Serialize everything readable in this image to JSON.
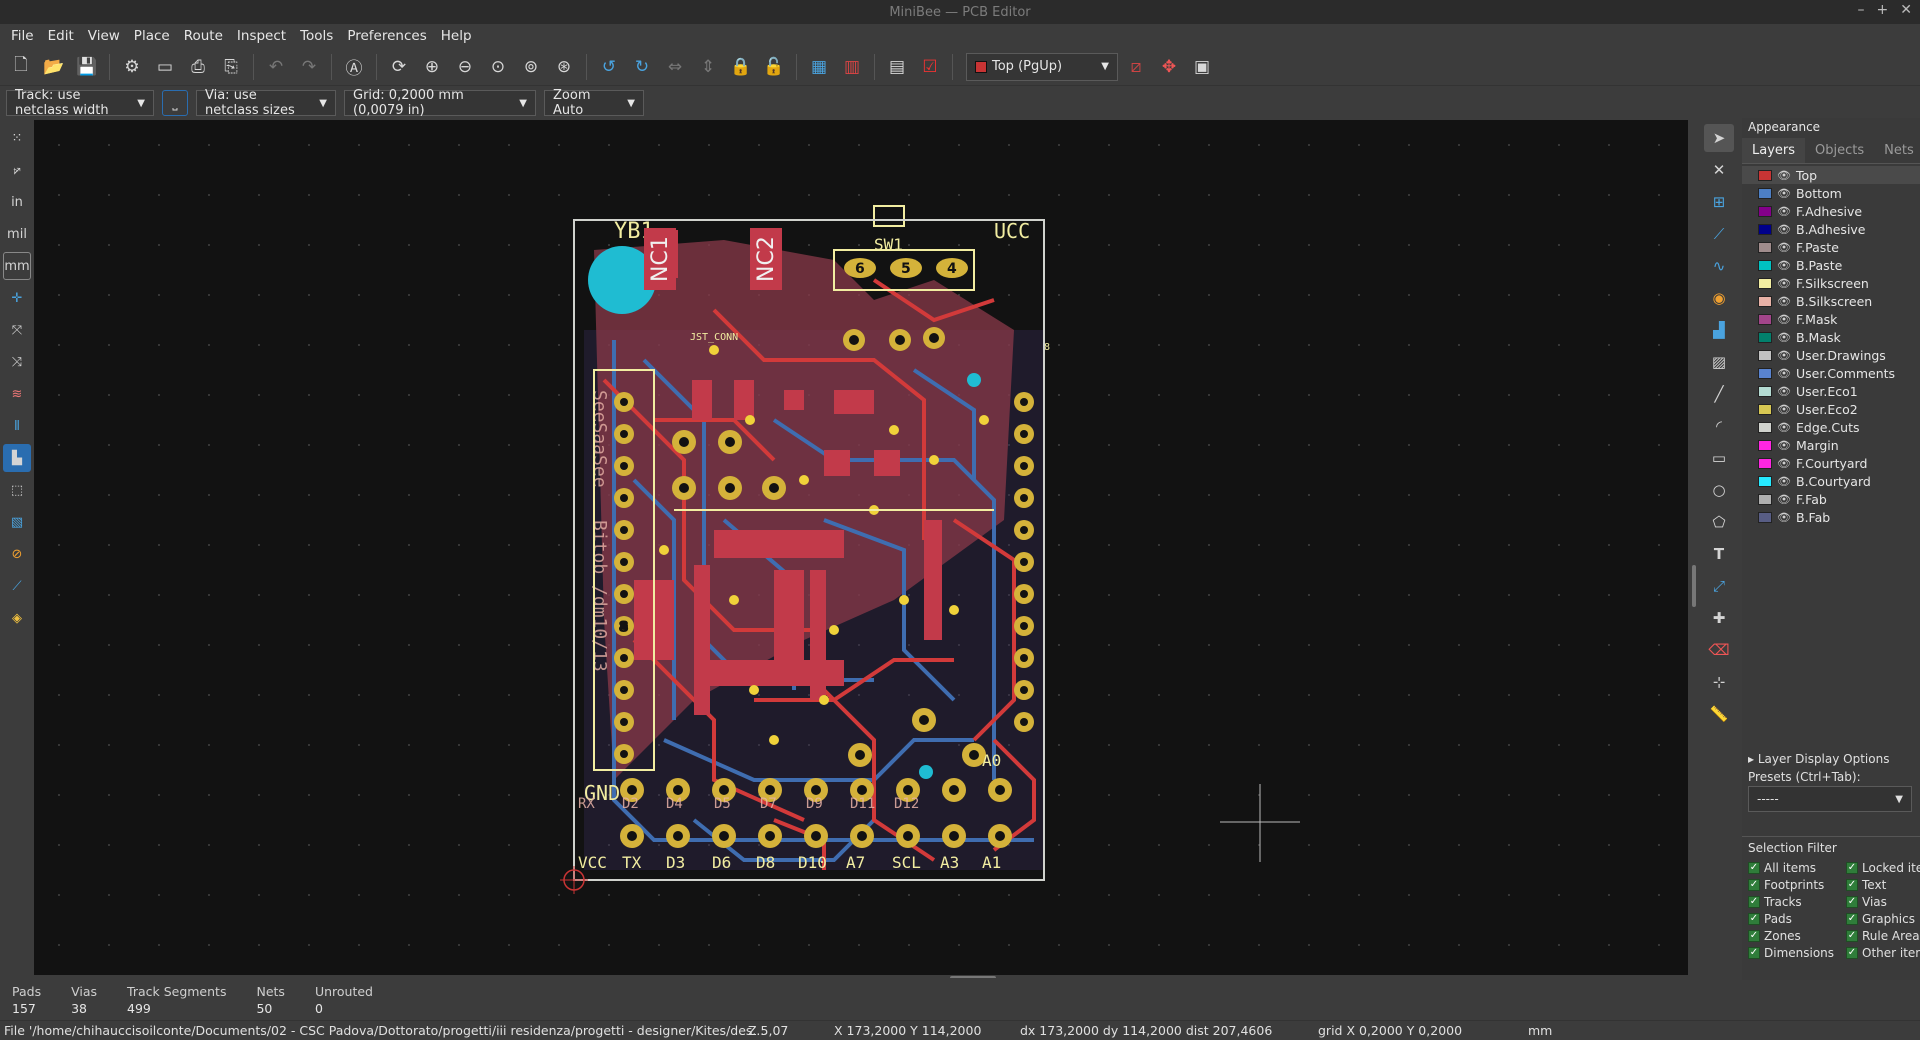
{
  "window": {
    "title": "MiniBee — PCB Editor",
    "controls": [
      "–",
      "+",
      "✕"
    ]
  },
  "menu": [
    "File",
    "Edit",
    "View",
    "Place",
    "Route",
    "Inspect",
    "Tools",
    "Preferences",
    "Help"
  ],
  "toolbar": {
    "layer_select": "Top (PgUp)",
    "track_width": "Track: use netclass width",
    "via_size": "Via: use netclass sizes",
    "grid": "Grid: 0,2000 mm (0,0079 in)",
    "zoom": "Zoom Auto"
  },
  "left_tools": [
    "grid-dots",
    "polar",
    "in",
    "mil",
    "mm",
    "cursor",
    "ratsnest",
    "curved-ratsnest",
    "hide-tracks",
    "show-tracks",
    "zone-fill",
    "zone-outline",
    "zone-none",
    "hv-45",
    "high-contrast",
    "layers-manager"
  ],
  "left_tool_labels": {
    "in": "in",
    "mil": "mil",
    "mm": "mm"
  },
  "appearance": {
    "title": "Appearance",
    "tabs": [
      "Layers",
      "Objects",
      "Nets"
    ],
    "active_tab": "Layers",
    "layers": [
      {
        "name": "Top",
        "color": "#c83434",
        "selected": true
      },
      {
        "name": "Bottom",
        "color": "#4d7fc4"
      },
      {
        "name": "F.Adhesive",
        "color": "#84008a"
      },
      {
        "name": "B.Adhesive",
        "color": "#00008a"
      },
      {
        "name": "F.Paste",
        "color": "#a08c8c"
      },
      {
        "name": "B.Paste",
        "color": "#00c2c2"
      },
      {
        "name": "F.Silkscreen",
        "color": "#f2eda1"
      },
      {
        "name": "B.Silkscreen",
        "color": "#e8b2a7"
      },
      {
        "name": "F.Mask",
        "color": "#a2458a"
      },
      {
        "name": "B.Mask",
        "color": "#02806c"
      },
      {
        "name": "User.Drawings",
        "color": "#c2c2c2"
      },
      {
        "name": "User.Comments",
        "color": "#5983cf"
      },
      {
        "name": "User.Eco1",
        "color": "#b4dbd2"
      },
      {
        "name": "User.Eco2",
        "color": "#d8c853"
      },
      {
        "name": "Edge.Cuts",
        "color": "#d0d2cd"
      },
      {
        "name": "Margin",
        "color": "#ff26e2"
      },
      {
        "name": "F.Courtyard",
        "color": "#ff26e2"
      },
      {
        "name": "B.Courtyard",
        "color": "#26e9ff"
      },
      {
        "name": "F.Fab",
        "color": "#afafaf"
      },
      {
        "name": "B.Fab",
        "color": "#585d84"
      }
    ],
    "layer_display_options": "Layer Display Options",
    "presets_label": "Presets (Ctrl+Tab):",
    "presets_value": "-----"
  },
  "selection_filter": {
    "title": "Selection Filter",
    "items": [
      "All items",
      "Locked ite",
      "Footprints",
      "Text",
      "Tracks",
      "Vias",
      "Pads",
      "Graphics",
      "Zones",
      "Rule Areas",
      "Dimensions",
      "Other item"
    ]
  },
  "stats": [
    {
      "label": "Pads",
      "value": "157"
    },
    {
      "label": "Vias",
      "value": "38"
    },
    {
      "label": "Track Segments",
      "value": "499"
    },
    {
      "label": "Nets",
      "value": "50"
    },
    {
      "label": "Unrouted",
      "value": "0"
    }
  ],
  "status": {
    "file": "File '/home/chihauccisoilconte/Documents/02 - CSC Padova/Dottorato/progetti/iii residenza/progetti - designer/Kites/des...",
    "zoom": "Z 5,07",
    "xy": "X 173,2000  Y 114,2000",
    "delta": "dx 173,2000  dy 114,2000  dist 207,4606",
    "grid": "grid X 0,2000  Y 0,2000",
    "units": "mm"
  },
  "board": {
    "silk_labels": [
      "YB1",
      "NC1",
      "NC2",
      "SW1",
      "GND",
      "JST_CONN",
      "UCC",
      "A0",
      "A1",
      "A3",
      "SCL",
      "A7",
      "D10",
      "D8",
      "D6",
      "D3",
      "TX",
      "VCC",
      "D2",
      "D4",
      "D5",
      "D7",
      "D9",
      "D11",
      "D12",
      "RX"
    ],
    "top_header_numbers": [
      "6",
      "5",
      "4"
    ],
    "side_label": "SeeSaaSee",
    "side_label2": "Bitob /dm10/13",
    "pin_number": "8"
  },
  "colors": {
    "top_copper": "#c83434",
    "bottom_copper": "#4d7fc4",
    "pad": "#d4b23a",
    "silk": "#f2eda1",
    "edge": "#d0d2cd",
    "via": "#00c2c2"
  }
}
